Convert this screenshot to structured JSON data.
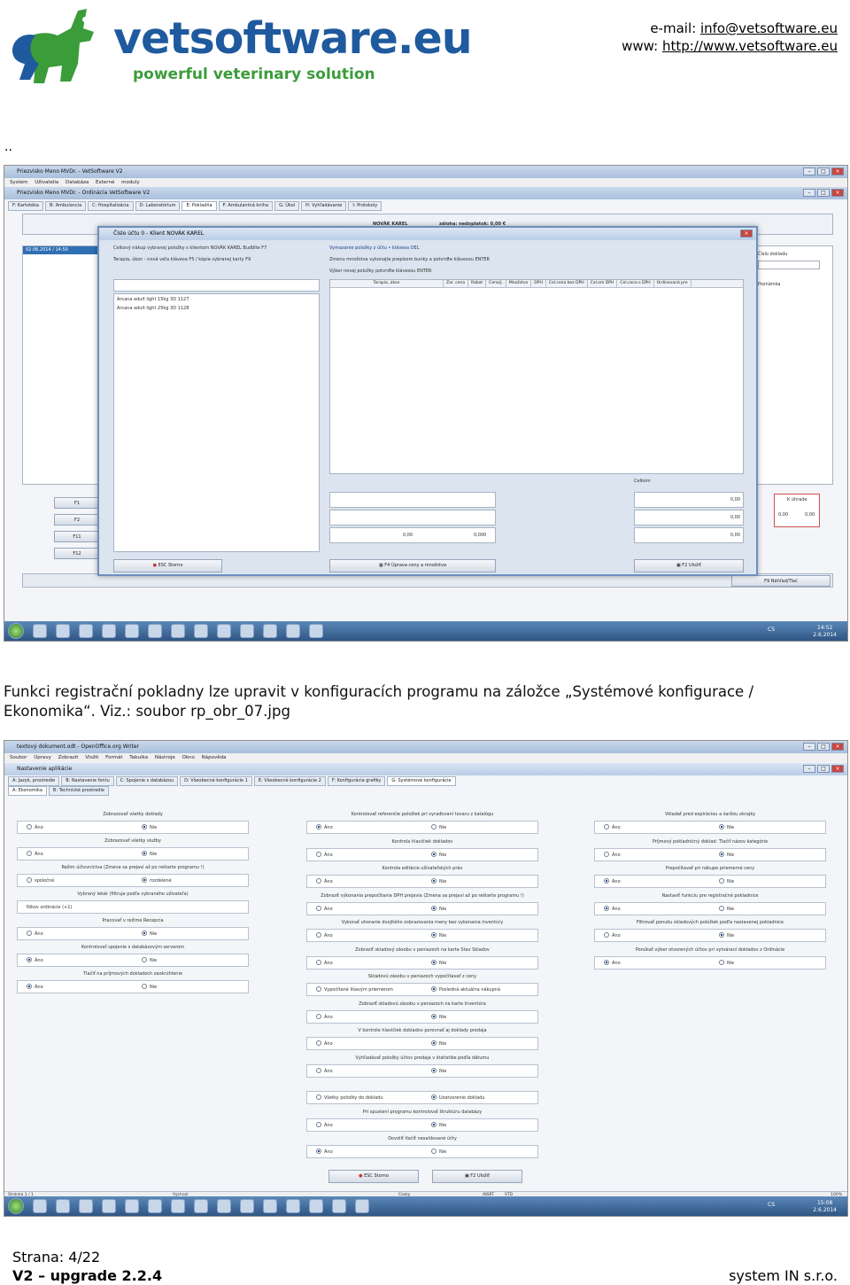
{
  "header": {
    "brand": "vetsoftware.eu",
    "tagline": "powerful veterinary solution",
    "email_label": "e-mail:",
    "email": "info@vetsoftware.eu",
    "www_label": "www:",
    "www": "http://www.vetsoftware.eu"
  },
  "separator": "..",
  "screenshot1": {
    "outer_title": "Priezvisko Meno MVDr. - VetSoftware V2",
    "outer_menu": "Systém Užívatelia Databáza Externé moduly",
    "inner_title": "Priezvisko Meno MVDr. - Ordinácia VetSoftware V2",
    "tabs": [
      "F: Kartotéka",
      "B: Ambulancia",
      "C: Hospitalizácia",
      "D: Laboratórium",
      "E: Pokladňa",
      "F: Ambulantná kniha",
      "G: Úkol",
      "H: Vyhľadávanie",
      "I: Protokoly"
    ],
    "date_row": "02.06.2014 / 14:50",
    "client_bar": "NOVÁK KAREL",
    "deposit": "záloha: nedoplatok: 0,00 €",
    "dialog": {
      "title": "Číslo účtu 0 - Klient NOVÁK KAREL",
      "hint1": "Celkový nákup vybranej položky s klientom NOVÁK KAREL Buďdíte F7",
      "hint2": "Terapia, úkon - nová veľa klávesa F5 / kópia vybranej karty F9",
      "hint3": "Vymazanie položky z účtu • klávesa DEL",
      "hint4": "Zmenu množstva vykonajte prepisom bunky a potvrďte klávesou ENTER",
      "hint5": "Výber novej položky potvrďte klávesou ENTER",
      "items": [
        "Arcana adult light 15kg 3D 1127",
        "Arcana adult light 25kg 3D 1128"
      ],
      "columns": [
        "Terapia, úkon",
        "Zar. cena",
        "Rabat",
        "Cena/j.",
        "Množstvo",
        "DPH",
        "Cel.cena bez DPH",
        "Cel.om DPH",
        "Cel.cena s DPH",
        "Ordinovaná pre"
      ],
      "total_label": "Celkom",
      "values": [
        "0,00",
        "0,00",
        "0,00",
        "0,00",
        "0,000"
      ],
      "payment_label": "K úhrade",
      "payment_values": [
        "0,00",
        "0,00"
      ],
      "btn_esc": "ESC Storno",
      "btn_f4": "F4 Úprava ceny a množstva",
      "btn_f2": "F2 Uložiť"
    },
    "right_labels": [
      "Číslo dokladu",
      "Poznámka"
    ],
    "bottom_bar_right": "F9 Náhľad/Tlač",
    "side_keys": [
      "F1",
      "F2",
      "F11",
      "F12"
    ],
    "clock_time": "14:52",
    "clock_date": "2.6.2014",
    "lang": "CS"
  },
  "caption": "Funkci registrační pokladny lze upravit v konfiguracích programu na záložce „Systémové konfigurace / Ekonomika“. Viz.: soubor rp_obr_07.jpg",
  "screenshot2": {
    "oo_title": "textový dokument.odt - OpenOffice.org Writer",
    "oo_menu": "Soubor Úpravy Zobrazit Vložit Formát Tabulka Nástroje Okno Nápověda",
    "dlg_title": "Nastavenie aplikácie",
    "tabs1": [
      "A: Jazyk, prostredie",
      "B: Nastavenie fontu",
      "C: Spojenie s databázou",
      "D: Všeobecné konfigurácie 1",
      "E: Všeobecné konfigurácie 2",
      "F: Konfigurácia grafiky",
      "G: Systémové konfigurácie"
    ],
    "tabs2": [
      "A: Ekonomika",
      "B: Technické prostredie"
    ],
    "col1": [
      {
        "q": "Zobrazovať všetky doklady",
        "o1": "Áno",
        "o2": "Nie",
        "sel": 2
      },
      {
        "q": "Zobrazovať všetky služby",
        "o1": "Áno",
        "o2": "Nie",
        "sel": 2
      },
      {
        "q": "Režim účtovníctva (Zmena sa prejaví až po reštarte programu !)",
        "o1": "spoločné",
        "o2": "rozdelené",
        "sel": 2
      },
      {
        "q": "Vybraný lekár (filtruje podľa vybraného užívateľa)",
        "o1": "Nikov ordinácie (+1)",
        "o2": "",
        "sel": 0
      },
      {
        "q": "Pracovať v režime Recepcia",
        "o1": "Áno",
        "o2": "Nie",
        "sel": 2
      },
      {
        "q": "Kontrolovať spojenie s databázovým serverom",
        "o1": "Áno",
        "o2": "Nie",
        "sel": 1
      },
      {
        "q": "Tlačiť na príjmových dokladoch zaokrúhlenie",
        "o1": "Áno",
        "o2": "Nie",
        "sel": 1
      }
    ],
    "col2": [
      {
        "q": "Kontrolovať referenčie položiek pri vyraďovaní tovaru z katalógu",
        "o1": "Áno",
        "o2": "Nie",
        "sel": 1
      },
      {
        "q": "Kontrola hlavičiek dokladov",
        "o1": "Áno",
        "o2": "Nie",
        "sel": 2
      },
      {
        "q": "Kontrola editácie užívateľských práv",
        "o1": "Áno",
        "o2": "Nie",
        "sel": 2
      },
      {
        "q": "Zobraziť výkonania prepočítania DPH prejavia (Zmena sa prejaví až po reštarte programu !)",
        "o1": "Áno",
        "o2": "Nie",
        "sel": 2
      },
      {
        "q": "Vykonať uhoranie dvojitého zobrazovania meny bez vykonania inventúry",
        "o1": "Áno",
        "o2": "Nie",
        "sel": 2
      },
      {
        "q": "Zobraziť skladový zásobu v peniazoch na karte Stav Skladov",
        "o1": "Áno",
        "o2": "Nie",
        "sel": 2
      },
      {
        "q": "Skladovú zásobu v peniazoch vypočítavať z ceny",
        "o1": "Vypočítané lišavým priemerom",
        "o2": "Posledná aktuálna nákupná",
        "sel": 2
      },
      {
        "q": "Zobraziť skladovú zásobu v peniazoch na karte Inventúra",
        "o1": "Áno",
        "o2": "Nie",
        "sel": 2
      },
      {
        "q": "V kontrole hlavičiek dokladov porovnať aj doklady predaja",
        "o1": "Áno",
        "o2": "Nie",
        "sel": 2
      },
      {
        "q": "Vyhľadávať položky účtov predaja v štatistike podľa dátumu",
        "o1": "Áno",
        "o2": "Nie",
        "sel": 2
      },
      {
        "q": "",
        "o1": "Všetky položky do dokladu",
        "o2": "Uzatvorenie dokladu",
        "sel": 2
      },
      {
        "q": "Pri spustení programu kontrolovať štruktúru databázy",
        "o1": "Áno",
        "o2": "Nie",
        "sel": 2
      },
      {
        "q": "Dovoliť tlačiť nesaldované účty",
        "o1": "Áno",
        "o2": "Nie",
        "sel": 1
      }
    ],
    "col3": [
      {
        "q": "Vkladať pred expiráciou a šaržou okrajky",
        "o1": "Áno",
        "o2": "Nie",
        "sel": 2
      },
      {
        "q": "Príjmový pokladničný doklad: Tlačiť názov kategórie",
        "o1": "Áno",
        "o2": "Nie",
        "sel": 2
      },
      {
        "q": "Prepočítavať pri nákupe priemerné ceny",
        "o1": "Áno",
        "o2": "Nie",
        "sel": 1
      },
      {
        "q": "Nastaviť funkciu pre registračné pokladnice",
        "o1": "Áno",
        "o2": "Nie",
        "sel": 1
      },
      {
        "q": "Filtrovať ponuku skladových položiek podľa nastavenej pokladnice",
        "o1": "Áno",
        "o2": "Nie",
        "sel": 2
      },
      {
        "q": "Ponúkať výber otvorených účtov pri vytváraní dokladov z Ordinácie",
        "o1": "Áno",
        "o2": "Nie",
        "sel": 1
      }
    ],
    "btn_esc": "ESC Storno",
    "btn_f2": "F2 Uložiť",
    "status_left": "Stránka 1 / 1",
    "status_mid": "Výchozí",
    "status_lang": "Česky",
    "status_ins": "INSRT",
    "status_std": "STD",
    "zoom": "100%",
    "clock_time": "15:08",
    "clock_date": "2.6.2014",
    "lang": "CS"
  },
  "footer": {
    "page": "Strana: 4/22",
    "version": "V2 – upgrade 2.2.4",
    "company": "system IN s.r.o."
  },
  "colors": {
    "brand_blue": "#1f5a9e",
    "brand_green": "#3b9c3a"
  }
}
